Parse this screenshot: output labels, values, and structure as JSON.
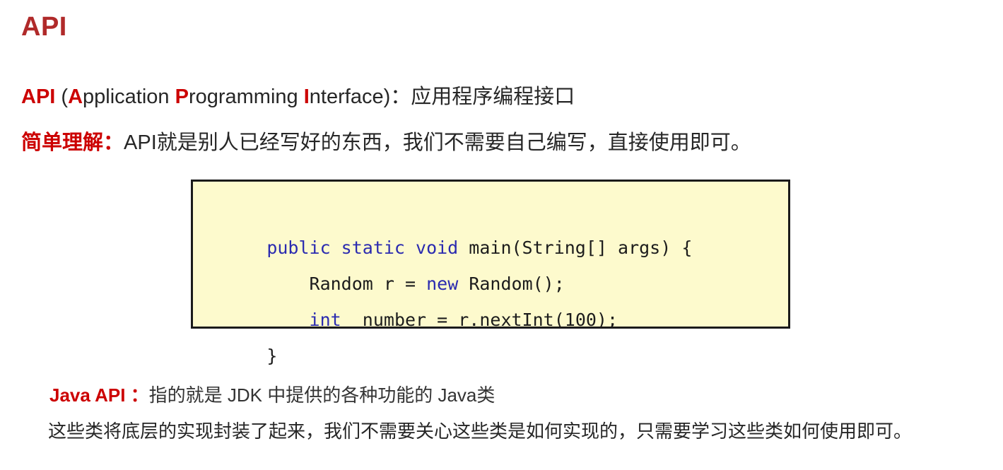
{
  "slide": {
    "title": "API",
    "title_color": "#b02a2a",
    "accent_color": "#cc0000",
    "background_color": "#ffffff"
  },
  "definition": {
    "abbr": "API",
    "open_paren": " (",
    "a_initial": "A",
    "a_rest": "pplication ",
    "p_initial": "P",
    "p_rest": "rogramming ",
    "i_initial": "I",
    "i_rest": "nterface",
    "close_paren": ")",
    "colon": "：",
    "chinese": "应用程序编程接口"
  },
  "explain": {
    "label": "简单理解：",
    "body": "API就是别人已经写好的东西，我们不需要自己编写，直接使用即可。"
  },
  "code": {
    "language": "java",
    "background_color": "#fdfacd",
    "border_color": "#1a1a1a",
    "keyword_color": "#2b2bb0",
    "lines": [
      {
        "segments": [
          {
            "text": "public static void ",
            "type": "keyword"
          },
          {
            "text": "main(String[] args) {",
            "type": "plain"
          }
        ]
      },
      {
        "segments": [
          {
            "text": "    Random r = ",
            "type": "plain"
          },
          {
            "text": "new ",
            "type": "keyword"
          },
          {
            "text": "Random();",
            "type": "plain"
          }
        ]
      },
      {
        "segments": [
          {
            "text": "    ",
            "type": "plain"
          },
          {
            "text": "int",
            "type": "keyword"
          },
          {
            "text": "  number = r.nextInt(100);",
            "type": "plain"
          }
        ]
      },
      {
        "segments": [
          {
            "text": "}",
            "type": "plain"
          }
        ]
      }
    ]
  },
  "java_api": {
    "label": "Java API ：",
    "body": "指的就是 JDK 中提供的各种功能的 Java类",
    "description": "这些类将底层的实现封装了起来，我们不需要关心这些类是如何实现的，只需要学习这些类如何使用即可。"
  }
}
